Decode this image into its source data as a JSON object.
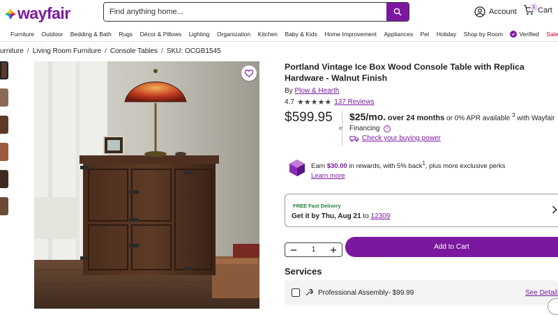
{
  "header": {
    "logo_text": "wayfair",
    "search_placeholder": "Find anything home...",
    "account_label": "Account",
    "cart_label": "Cart",
    "cart_count": "1"
  },
  "categories": [
    "Furniture",
    "Outdoor",
    "Bedding & Bath",
    "Rugs",
    "Décor & Pillows",
    "Lighting",
    "Organization",
    "Kitchen",
    "Baby & Kids",
    "Home Improvement",
    "Appliances",
    "Pet",
    "Holiday",
    "Shop by Room"
  ],
  "category_verified": "Verified",
  "category_sale": "Sale",
  "breadcrumb": [
    "urniture",
    "Living Room Furniture",
    "Console Tables",
    "SKU: OCGB1545"
  ],
  "product": {
    "title": "Portland Vintage Ice Box Wood Console Table with Replica Hardware - Walnut Finish",
    "by_label": "By",
    "brand": "Plow & Hearth",
    "rating": "4.7",
    "reviews": "137 Reviews",
    "price": "$599.95",
    "or": "or",
    "monthly": "$25/mo.",
    "monthly_term": "over 24 months",
    "apr_text": "or 0% APR available",
    "apr_note": "3",
    "apr_tail": "with Wayfair Financing",
    "check_power": "Check your buying power"
  },
  "rewards": {
    "earn": "Earn",
    "amount": "$30.00",
    "text": "in rewards, with 5% back",
    "note": "1",
    "tail": ", plus more exclusive perks",
    "learn_more": "Learn more"
  },
  "shipping": {
    "badge": "FREE Fast Delivery",
    "get_it_by": "Get it by Thu, Aug 21",
    "to": "to",
    "zip": "12309"
  },
  "purchase": {
    "quantity": "1",
    "add_to_cart": "Add to Cart"
  },
  "services": {
    "heading": "Services",
    "item_label": "Professional Assembly- $99.99",
    "see_details": "See Details"
  },
  "colors": {
    "brand": "#7b189f",
    "free_green": "#1a7f37",
    "sale_red": "#b5002a"
  }
}
